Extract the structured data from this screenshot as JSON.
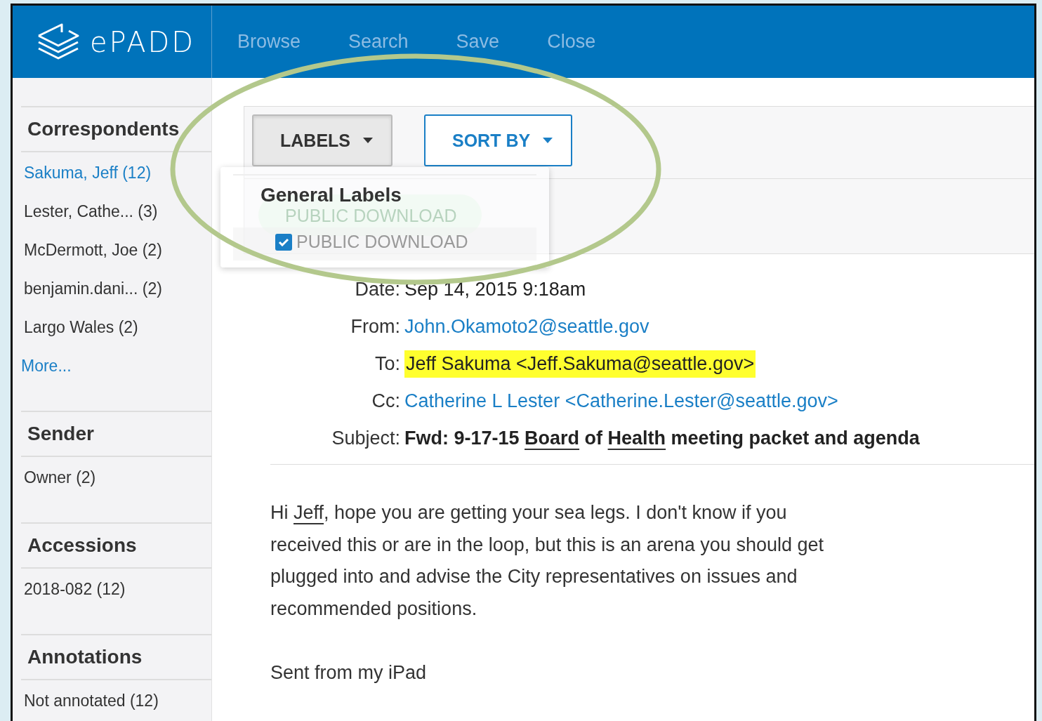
{
  "header": {
    "logo": "ePADD",
    "nav": [
      {
        "label": "Browse"
      },
      {
        "label": "Search"
      },
      {
        "label": "Save"
      },
      {
        "label": "Close"
      }
    ]
  },
  "sidebar": {
    "sections": [
      {
        "title": "Correspondents",
        "items": [
          {
            "text": "Sakuma, Jeff (12)",
            "selected": true
          },
          {
            "text": "Lester, Cathe... (3)",
            "selected": false
          },
          {
            "text": "McDermott, Joe (2)",
            "selected": false
          },
          {
            "text": "benjamin.dani... (2)",
            "selected": false
          },
          {
            "text": "Largo Wales (2)",
            "selected": false
          }
        ],
        "more": "More..."
      },
      {
        "title": "Sender",
        "items": [
          {
            "text": "Owner (2)",
            "selected": false
          }
        ]
      },
      {
        "title": "Accessions",
        "items": [
          {
            "text": "2018-082 (12)",
            "selected": false
          }
        ]
      },
      {
        "title": "Annotations",
        "items": [
          {
            "text": "Not annotated (12)",
            "selected": false
          }
        ]
      }
    ]
  },
  "toolbar": {
    "buttons": [
      {
        "label": "LABELS",
        "kind": "pressed"
      },
      {
        "label": "SORT BY",
        "kind": "outline"
      }
    ]
  },
  "labels_dropdown": {
    "heading": "General Labels",
    "options": [
      {
        "label": "PUBLIC DOWNLOAD",
        "checked": true
      }
    ]
  },
  "message_labels": [
    "PUBLIC DOWNLOAD"
  ],
  "message": {
    "fields": [
      {
        "label": "Date:",
        "kind": "plain",
        "segments": [
          {
            "text": "Sep 14, 2015 9:18am",
            "entity": false
          }
        ]
      },
      {
        "label": "From:",
        "kind": "link",
        "segments": [
          {
            "text": "John.Okamoto2@seattle.gov",
            "entity": false
          }
        ]
      },
      {
        "label": "To:",
        "kind": "highlight",
        "segments": [
          {
            "text": "Jeff Sakuma <Jeff.Sakuma@seattle.gov>",
            "entity": false
          }
        ]
      },
      {
        "label": "Cc:",
        "kind": "link",
        "segments": [
          {
            "text": "Catherine L Lester <Catherine.Lester@seattle.gov>",
            "entity": false
          }
        ]
      },
      {
        "label": "Subject:",
        "kind": "bold",
        "segments": [
          {
            "text": "Fwd: 9-17-15 ",
            "entity": false
          },
          {
            "text": "Board",
            "entity": true
          },
          {
            "text": " of ",
            "entity": false
          },
          {
            "text": "Health",
            "entity": true
          },
          {
            "text": " meeting packet and agenda",
            "entity": false
          }
        ]
      }
    ],
    "body": [
      [
        {
          "text": "Hi ",
          "entity": false
        },
        {
          "text": "Jeff",
          "entity": true
        },
        {
          "text": ", hope you are getting your sea legs. I don't know if you received this or are in the loop, but this is an arena you should get plugged into and advise the City representatives on issues and recommended positions.",
          "entity": false
        }
      ],
      [
        {
          "text": "Sent from my iPad",
          "entity": false
        }
      ]
    ]
  }
}
